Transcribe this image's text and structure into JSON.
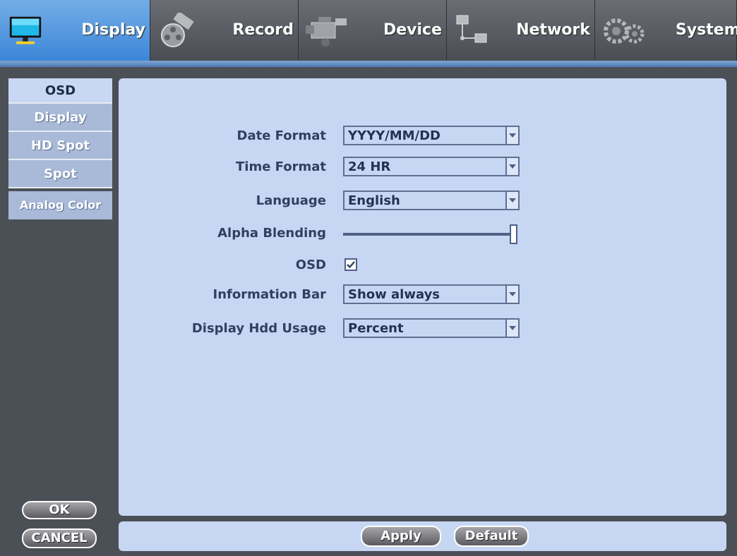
{
  "tabs": [
    {
      "label": "Display",
      "icon": "monitor-icon",
      "active": true
    },
    {
      "label": "Record",
      "icon": "film-reel-icon",
      "active": false
    },
    {
      "label": "Device",
      "icon": "camcorder-icon",
      "active": false
    },
    {
      "label": "Network",
      "icon": "network-icon",
      "active": false
    },
    {
      "label": "System",
      "icon": "gears-icon",
      "active": false
    }
  ],
  "sidebar": {
    "items": [
      {
        "label": "OSD",
        "active": true
      },
      {
        "label": "Display",
        "active": false
      },
      {
        "label": "HD Spot",
        "active": false
      },
      {
        "label": "Spot",
        "active": false
      },
      {
        "label": "Analog Color",
        "active": false
      }
    ]
  },
  "form": {
    "date_format": {
      "label": "Date Format",
      "value": "YYYY/MM/DD"
    },
    "time_format": {
      "label": "Time Format",
      "value": "24 HR"
    },
    "language": {
      "label": "Language",
      "value": "English"
    },
    "alpha_blending": {
      "label": "Alpha Blending",
      "level": 1.0
    },
    "osd": {
      "label": "OSD",
      "checked": true
    },
    "information_bar": {
      "label": "Information Bar",
      "value": "Show always"
    },
    "display_hdd_usage": {
      "label": "Display Hdd Usage",
      "value": "Percent"
    }
  },
  "buttons": {
    "ok": "OK",
    "cancel": "CANCEL",
    "apply": "Apply",
    "default": "Default"
  },
  "colors": {
    "active_tab": "#3c86d8",
    "panel": "#c7d7f3",
    "frame": "#4b4f56"
  }
}
